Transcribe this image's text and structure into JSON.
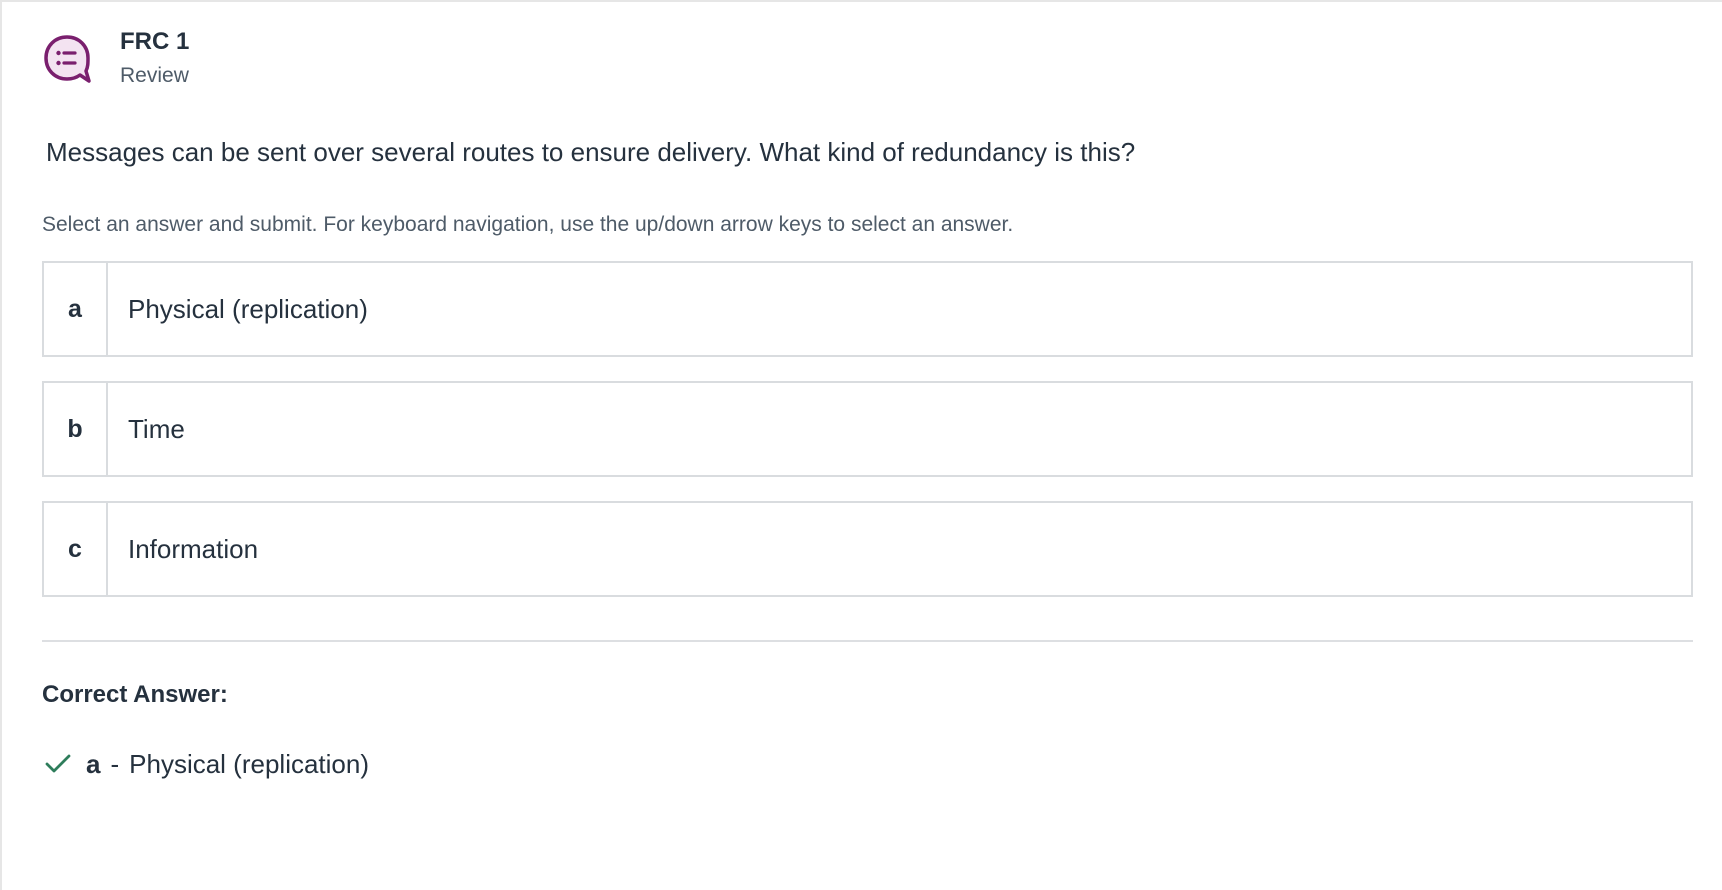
{
  "header": {
    "title": "FRC 1",
    "subtitle": "Review",
    "icon": "chat-list-icon",
    "icon_color": "#7a1f6e"
  },
  "question": {
    "text": "Messages can be sent over several routes to ensure delivery. What kind of redundancy is this?",
    "instructions": "Select an answer and submit. For keyboard navigation, use the up/down arrow keys to select an answer."
  },
  "options": [
    {
      "letter": "a",
      "label": "Physical (replication)"
    },
    {
      "letter": "b",
      "label": "Time"
    },
    {
      "letter": "c",
      "label": "Information"
    }
  ],
  "correct": {
    "heading": "Correct Answer:",
    "letter": "a",
    "separator": "-",
    "label": "Physical (replication)",
    "icon": "checkmark-icon",
    "icon_color": "#2e7d5b"
  }
}
